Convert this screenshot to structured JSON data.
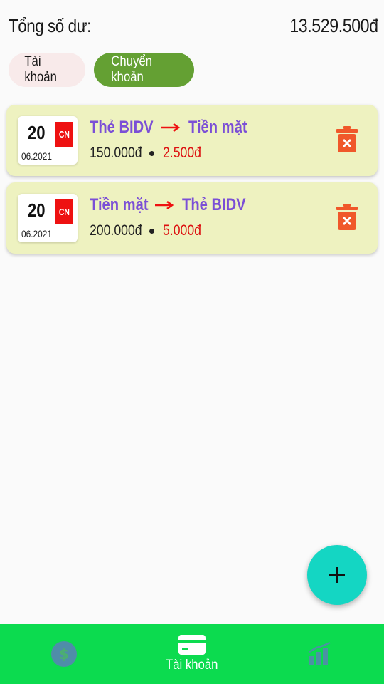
{
  "header": {
    "title": "Tổng số dư:",
    "total": "13.529.500đ"
  },
  "tabs": [
    {
      "label": "Tài khoản",
      "active": false
    },
    {
      "label": "Chuyển khoản",
      "active": true
    }
  ],
  "transfers": [
    {
      "day": "20",
      "weekday": "CN",
      "month_year": "06.2021",
      "from": "Thẻ BIDV",
      "to": "Tiền mặt",
      "amount": "150.000đ",
      "fee": "2.500đ"
    },
    {
      "day": "20",
      "weekday": "CN",
      "month_year": "06.2021",
      "from": "Tiền mặt",
      "to": "Thẻ BIDV",
      "amount": "200.000đ",
      "fee": "5.000đ"
    }
  ],
  "fab": {
    "icon": "plus-icon"
  },
  "bottom_nav": {
    "items": [
      {
        "icon": "dollar-coin-icon",
        "label": "",
        "active": false
      },
      {
        "icon": "card-icon",
        "label": "Tài khoản",
        "active": true
      },
      {
        "icon": "chart-icon",
        "label": "",
        "active": false
      }
    ]
  },
  "colors": {
    "accent_green": "#64a033",
    "nav_green": "#0cdb4f",
    "card_bg": "#eef2c0",
    "account_purple": "#7b4fd6",
    "fee_red": "#dd1111",
    "fab_teal": "#14d6c3",
    "trash_orange": "#f0582a"
  }
}
